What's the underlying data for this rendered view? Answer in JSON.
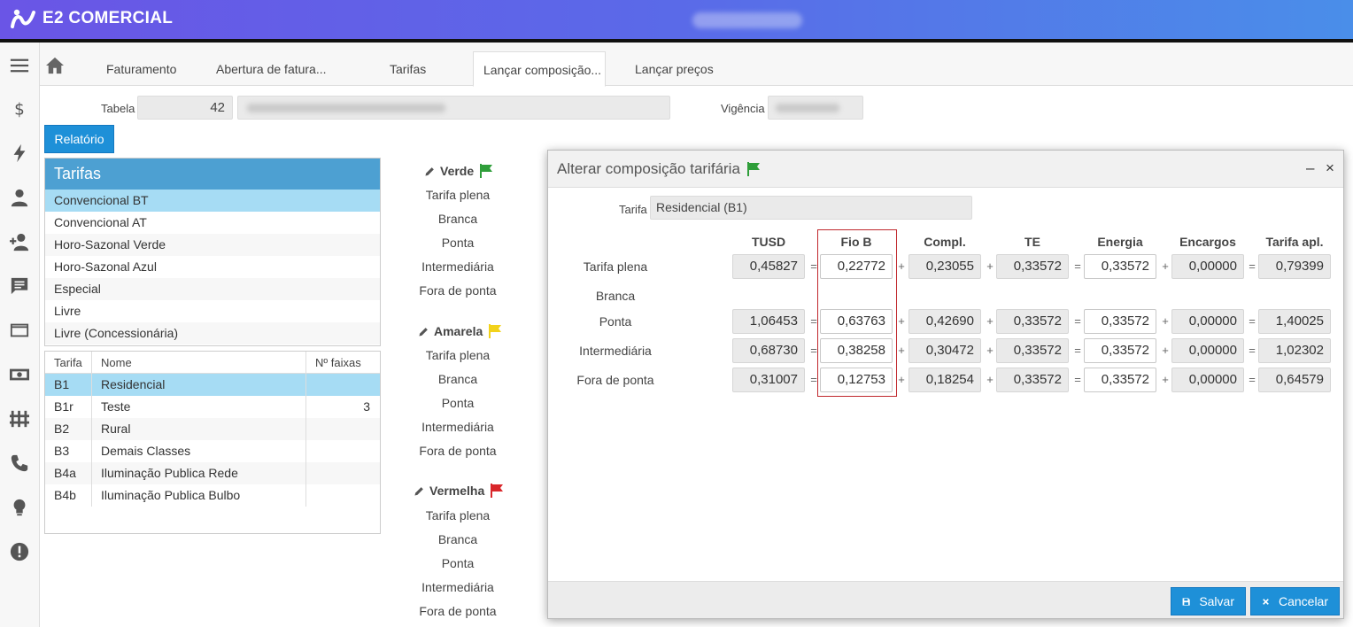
{
  "app": {
    "brand": "E2 COMERCIAL"
  },
  "tabs": [
    {
      "label": "Faturamento"
    },
    {
      "label": "Abertura de fatura..."
    },
    {
      "label": "Tarifas"
    },
    {
      "label": "Lançar composição..."
    },
    {
      "label": "Lançar preços"
    }
  ],
  "form": {
    "tabela_label": "Tabela",
    "tabela_value": "42",
    "vigencia_label": "Vigência",
    "relatorio_button": "Relatório"
  },
  "tarifas_panel": {
    "title": "Tarifas",
    "items": [
      "Convencional BT",
      "Convencional AT",
      "Horo-Sazonal Verde",
      "Horo-Sazonal Azul",
      "Especial",
      "Livre",
      "Livre (Concessionária)"
    ],
    "selected_index": 0
  },
  "grid": {
    "headers": {
      "tarifa": "Tarifa",
      "nome": "Nome",
      "faixas": "Nº faixas"
    },
    "rows": [
      {
        "tarifa": "B1",
        "nome": "Residencial",
        "faixas": ""
      },
      {
        "tarifa": "B1r",
        "nome": "Teste",
        "faixas": "3"
      },
      {
        "tarifa": "B2",
        "nome": "Rural",
        "faixas": ""
      },
      {
        "tarifa": "B3",
        "nome": "Demais Classes",
        "faixas": ""
      },
      {
        "tarifa": "B4a",
        "nome": "Iluminação Publica Rede",
        "faixas": ""
      },
      {
        "tarifa": "B4b",
        "nome": "Iluminação Publica Bulbo",
        "faixas": ""
      }
    ]
  },
  "flags": [
    {
      "name": "Verde",
      "color": "#2f9e3a",
      "items": [
        "Tarifa plena",
        "Branca",
        "Ponta",
        "Intermediária",
        "Fora de ponta"
      ]
    },
    {
      "name": "Amarela",
      "color": "#f2d21b",
      "items": [
        "Tarifa plena",
        "Branca",
        "Ponta",
        "Intermediária",
        "Fora de ponta"
      ]
    },
    {
      "name": "Vermelha",
      "color": "#d9262a",
      "items": [
        "Tarifa plena",
        "Branca",
        "Ponta",
        "Intermediária",
        "Fora de ponta"
      ]
    }
  ],
  "modal": {
    "title": "Alterar composição tarifária",
    "title_flag_color": "#2f9e3a",
    "minimize": "–",
    "close": "×",
    "tarifa_label": "Tarifa",
    "tarifa_value": "Residencial (B1)",
    "columns": [
      "TUSD",
      "Fio B",
      "Compl.",
      "TE",
      "Energia",
      "Encargos",
      "Tarifa apl."
    ],
    "operators": [
      "=",
      "+",
      "+",
      "=",
      "+",
      "="
    ],
    "rows": [
      {
        "label": "Tarifa plena",
        "values": [
          "0,45827",
          "0,22772",
          "0,23055",
          "0,33572",
          "0,33572",
          "0,00000",
          "0,79399"
        ]
      },
      {
        "label": "Branca",
        "values": []
      },
      {
        "label": "Ponta",
        "values": [
          "1,06453",
          "0,63763",
          "0,42690",
          "0,33572",
          "0,33572",
          "0,00000",
          "1,40025"
        ]
      },
      {
        "label": "Intermediária",
        "values": [
          "0,68730",
          "0,38258",
          "0,30472",
          "0,33572",
          "0,33572",
          "0,00000",
          "1,02302"
        ]
      },
      {
        "label": "Fora de ponta",
        "values": [
          "0,31007",
          "0,12753",
          "0,18254",
          "0,33572",
          "0,33572",
          "0,00000",
          "0,64579"
        ]
      }
    ],
    "save_button": "Salvar",
    "cancel_button": "Cancelar"
  },
  "colors": {
    "accent": "#1e90d8",
    "selected": "#a6dcf4",
    "panel_head": "#4da0d2",
    "highlight_border": "#c0282d"
  }
}
